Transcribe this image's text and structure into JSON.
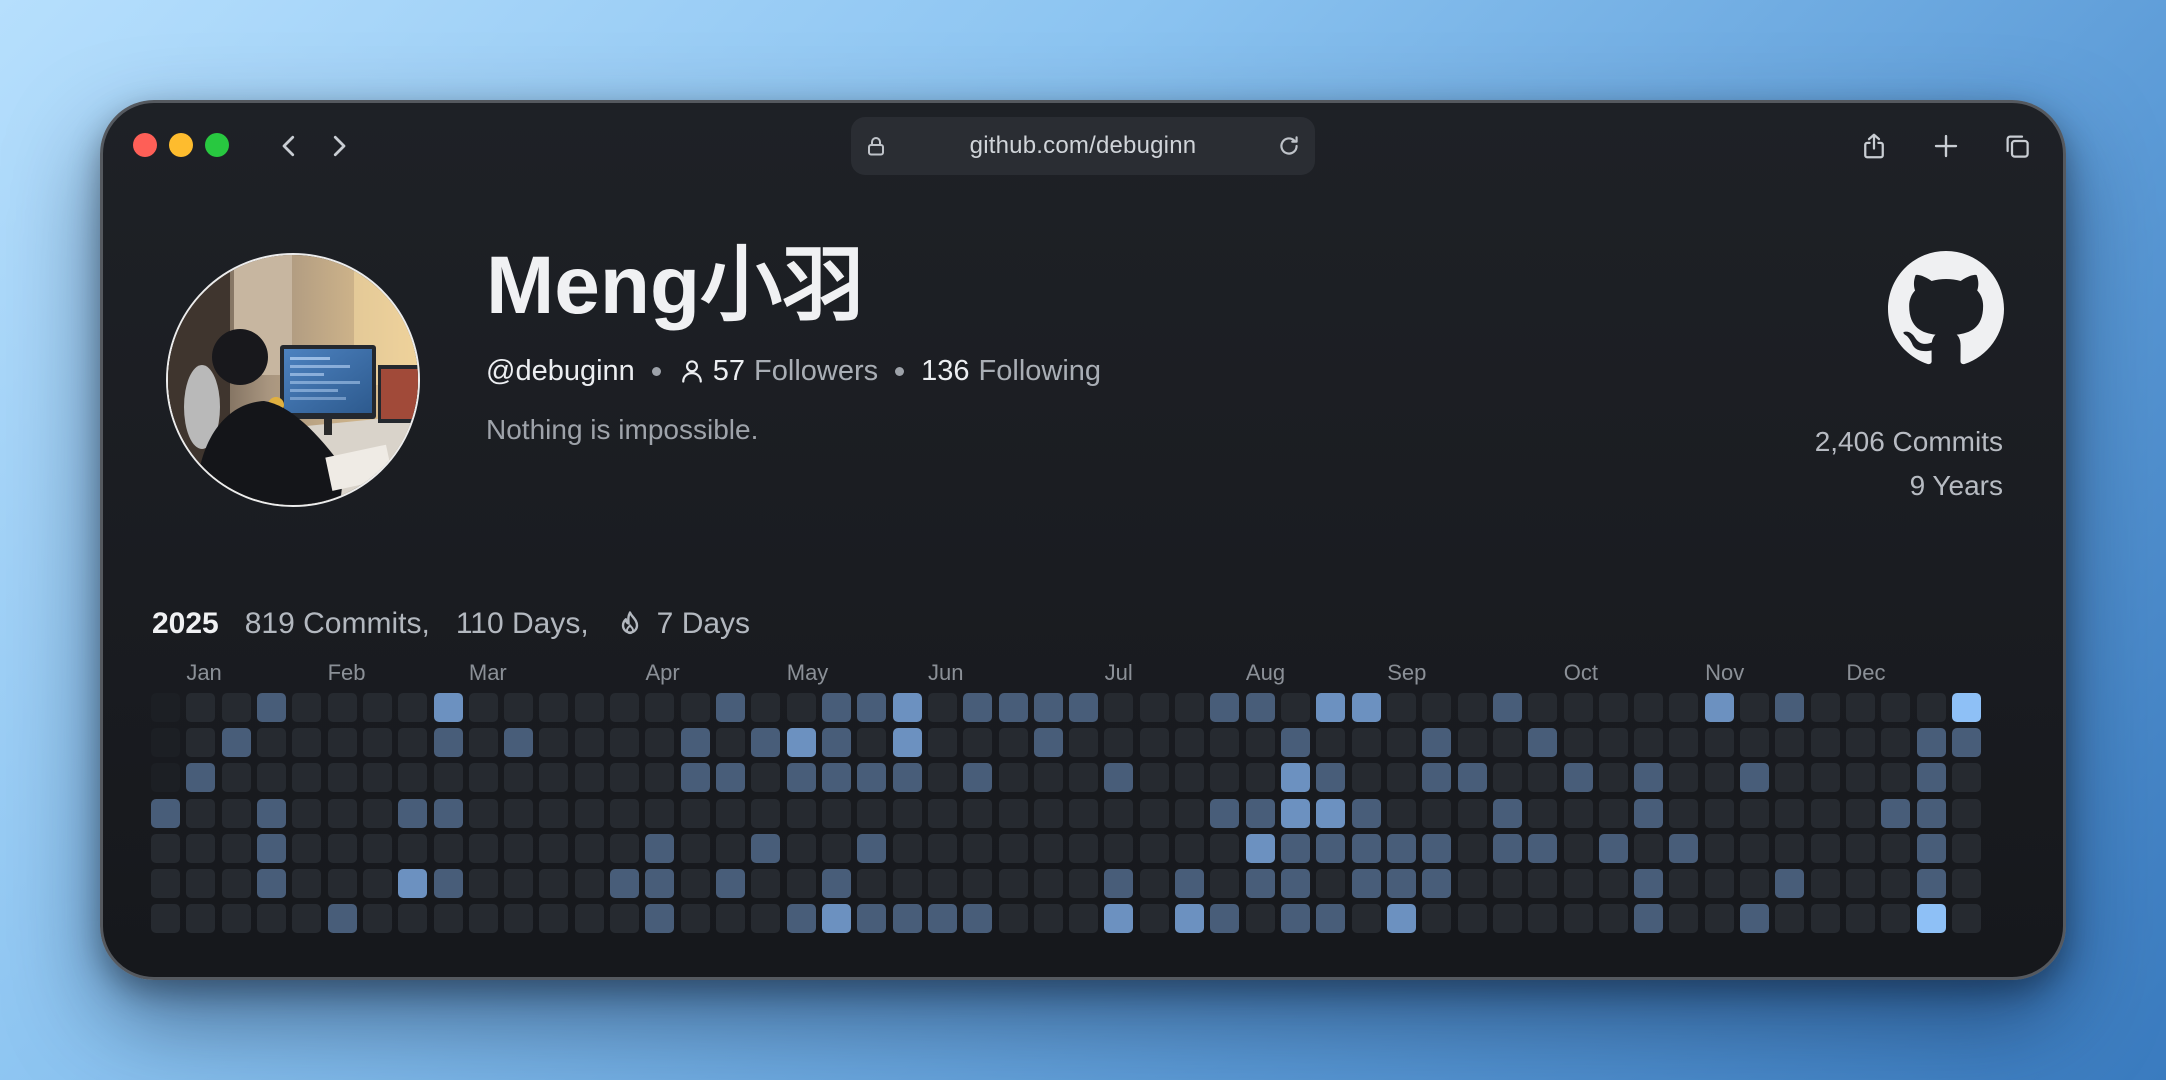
{
  "browser": {
    "url": "github.com/debuginn",
    "icons": {
      "back": "chevron-left-icon",
      "forward": "chevron-right-icon",
      "lock": "lock-icon",
      "reload": "reload-icon",
      "share": "share-icon",
      "new_tab": "plus-icon",
      "tabs": "tabs-overview-icon"
    }
  },
  "profile": {
    "name": "Meng小羽",
    "handle": "@debuginn",
    "followers": {
      "count": "57",
      "label": "Followers"
    },
    "following": {
      "count": "136",
      "label": "Following"
    },
    "bio": "Nothing is impossible.",
    "total_commits": "2,406 Commits",
    "years": "9 Years",
    "icons": {
      "followers": "person-icon",
      "brand": "github-logo-icon"
    }
  },
  "activity": {
    "year": "2025",
    "commits": "819 Commits,",
    "active_days": "110 Days,",
    "streak": "7 Days",
    "streak_icon": "flame-icon",
    "heatmap": {
      "months": [
        "Jan",
        "Feb",
        "Mar",
        "Apr",
        "May",
        "Jun",
        "Jul",
        "Aug",
        "Sep",
        "Oct",
        "Nov",
        "Dec"
      ],
      "level_colors": {
        "none": "#1c1f24",
        "0": "#262a30",
        "2": "#485d79",
        "3": "#6c91c0",
        "4": "#8ec0f6"
      },
      "levels": [
        [
          null,
          0,
          0,
          2,
          0,
          0,
          0,
          0,
          3,
          0,
          0,
          0,
          0,
          0,
          0,
          0,
          2,
          0,
          0,
          2,
          2,
          3,
          0,
          2,
          2,
          2,
          2,
          0,
          0,
          0,
          2,
          2,
          0,
          3,
          3,
          0,
          0,
          0,
          2,
          0,
          0,
          0,
          0,
          0,
          3,
          0,
          2,
          0,
          0,
          0,
          0,
          4
        ],
        [
          null,
          0,
          2,
          0,
          0,
          0,
          0,
          0,
          2,
          0,
          2,
          0,
          0,
          0,
          0,
          2,
          0,
          2,
          3,
          2,
          0,
          3,
          0,
          0,
          0,
          2,
          0,
          0,
          0,
          0,
          0,
          0,
          2,
          0,
          0,
          0,
          2,
          0,
          0,
          2,
          0,
          0,
          0,
          0,
          0,
          0,
          0,
          0,
          0,
          0,
          2,
          2
        ],
        [
          null,
          2,
          0,
          0,
          0,
          0,
          0,
          0,
          0,
          0,
          0,
          0,
          0,
          0,
          0,
          2,
          2,
          0,
          2,
          2,
          2,
          2,
          0,
          2,
          0,
          0,
          0,
          2,
          0,
          0,
          0,
          0,
          3,
          2,
          0,
          0,
          2,
          2,
          0,
          0,
          2,
          0,
          2,
          0,
          0,
          2,
          0,
          0,
          0,
          0,
          2,
          0
        ],
        [
          2,
          0,
          0,
          2,
          0,
          0,
          0,
          2,
          2,
          0,
          0,
          0,
          0,
          0,
          0,
          0,
          0,
          0,
          0,
          0,
          0,
          0,
          0,
          0,
          0,
          0,
          0,
          0,
          0,
          0,
          2,
          2,
          3,
          3,
          2,
          0,
          0,
          0,
          2,
          0,
          0,
          0,
          2,
          0,
          0,
          0,
          0,
          0,
          0,
          2,
          2,
          0
        ],
        [
          0,
          0,
          0,
          2,
          0,
          0,
          0,
          0,
          0,
          0,
          0,
          0,
          0,
          0,
          2,
          0,
          0,
          2,
          0,
          0,
          2,
          0,
          0,
          0,
          0,
          0,
          0,
          0,
          0,
          0,
          0,
          3,
          2,
          2,
          2,
          2,
          2,
          0,
          2,
          2,
          0,
          2,
          0,
          2,
          0,
          0,
          0,
          0,
          0,
          0,
          2,
          0
        ],
        [
          0,
          0,
          0,
          2,
          0,
          0,
          0,
          3,
          2,
          0,
          0,
          0,
          0,
          2,
          2,
          0,
          2,
          0,
          0,
          2,
          0,
          0,
          0,
          0,
          0,
          0,
          0,
          2,
          0,
          2,
          0,
          2,
          2,
          0,
          2,
          2,
          2,
          0,
          0,
          0,
          0,
          0,
          2,
          0,
          0,
          0,
          2,
          0,
          0,
          0,
          2,
          0
        ],
        [
          0,
          0,
          0,
          0,
          0,
          2,
          0,
          0,
          0,
          0,
          0,
          0,
          0,
          0,
          2,
          0,
          0,
          0,
          2,
          3,
          2,
          2,
          2,
          2,
          0,
          0,
          0,
          3,
          0,
          3,
          2,
          0,
          2,
          2,
          0,
          3,
          0,
          0,
          0,
          0,
          0,
          0,
          2,
          0,
          0,
          2,
          0,
          0,
          0,
          0,
          4,
          0
        ]
      ]
    }
  }
}
